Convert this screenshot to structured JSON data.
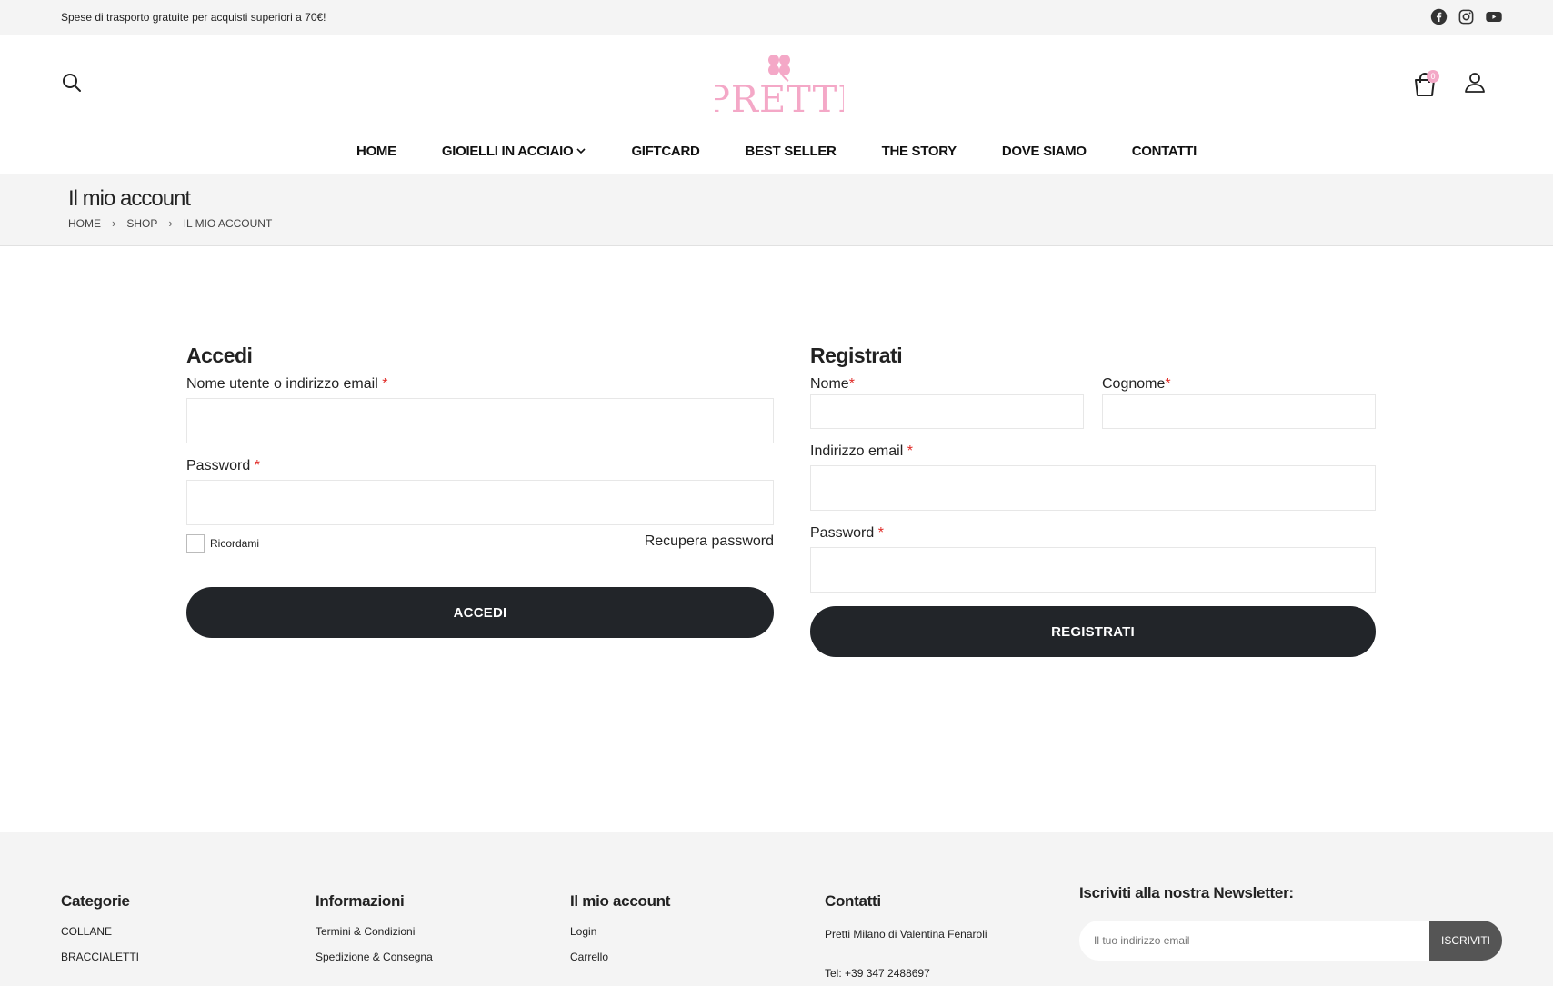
{
  "topbar": {
    "promo": "Spese di trasporto gratuite per acquisti superiori a 70€!"
  },
  "header": {
    "logo_text": "PRETTI",
    "cart_count": "0"
  },
  "nav": {
    "items": [
      {
        "label": "HOME"
      },
      {
        "label": "GIOIELLI IN ACCIAIO",
        "has_dropdown": true
      },
      {
        "label": "GIFTCARD"
      },
      {
        "label": "BEST SELLER"
      },
      {
        "label": "THE STORY"
      },
      {
        "label": "DOVE SIAMO"
      },
      {
        "label": "CONTATTI"
      }
    ]
  },
  "banner": {
    "title": "Il mio account",
    "breadcrumb": [
      "HOME",
      "SHOP",
      "IL MIO ACCOUNT"
    ]
  },
  "login": {
    "title": "Accedi",
    "username_label": "Nome utente o indirizzo email",
    "password_label": "Password",
    "required_mark": "*",
    "remember_label": "Ricordami",
    "recover_link": "Recupera password",
    "submit_label": "ACCEDI"
  },
  "register": {
    "title": "Registrati",
    "first_name_label": "Nome",
    "last_name_label": "Cognome",
    "email_label": "Indirizzo email",
    "password_label": "Password",
    "required_mark": "*",
    "submit_label": "REGISTRATI"
  },
  "footer": {
    "categories": {
      "title": "Categorie",
      "items": [
        "COLLANE",
        "BRACCIALETTI"
      ]
    },
    "info": {
      "title": "Informazioni",
      "items": [
        "Termini & Condizioni",
        "Spedizione & Consegna"
      ]
    },
    "account": {
      "title": "Il mio account",
      "items": [
        "Login",
        "Carrello"
      ]
    },
    "contacts": {
      "title": "Contatti",
      "items": [
        "Pretti Milano di Valentina Fenaroli",
        "Tel: +39 347 2488697"
      ]
    },
    "newsletter": {
      "title": "Iscriviti alla nostra Newsletter:",
      "placeholder": "Il tuo indirizzo email",
      "button": "ISCRIVITI"
    }
  },
  "colors": {
    "brand_pink": "#f4a8c7",
    "dark_button": "#222529",
    "required": "#e02b27",
    "light_bg": "#f4f4f4"
  }
}
